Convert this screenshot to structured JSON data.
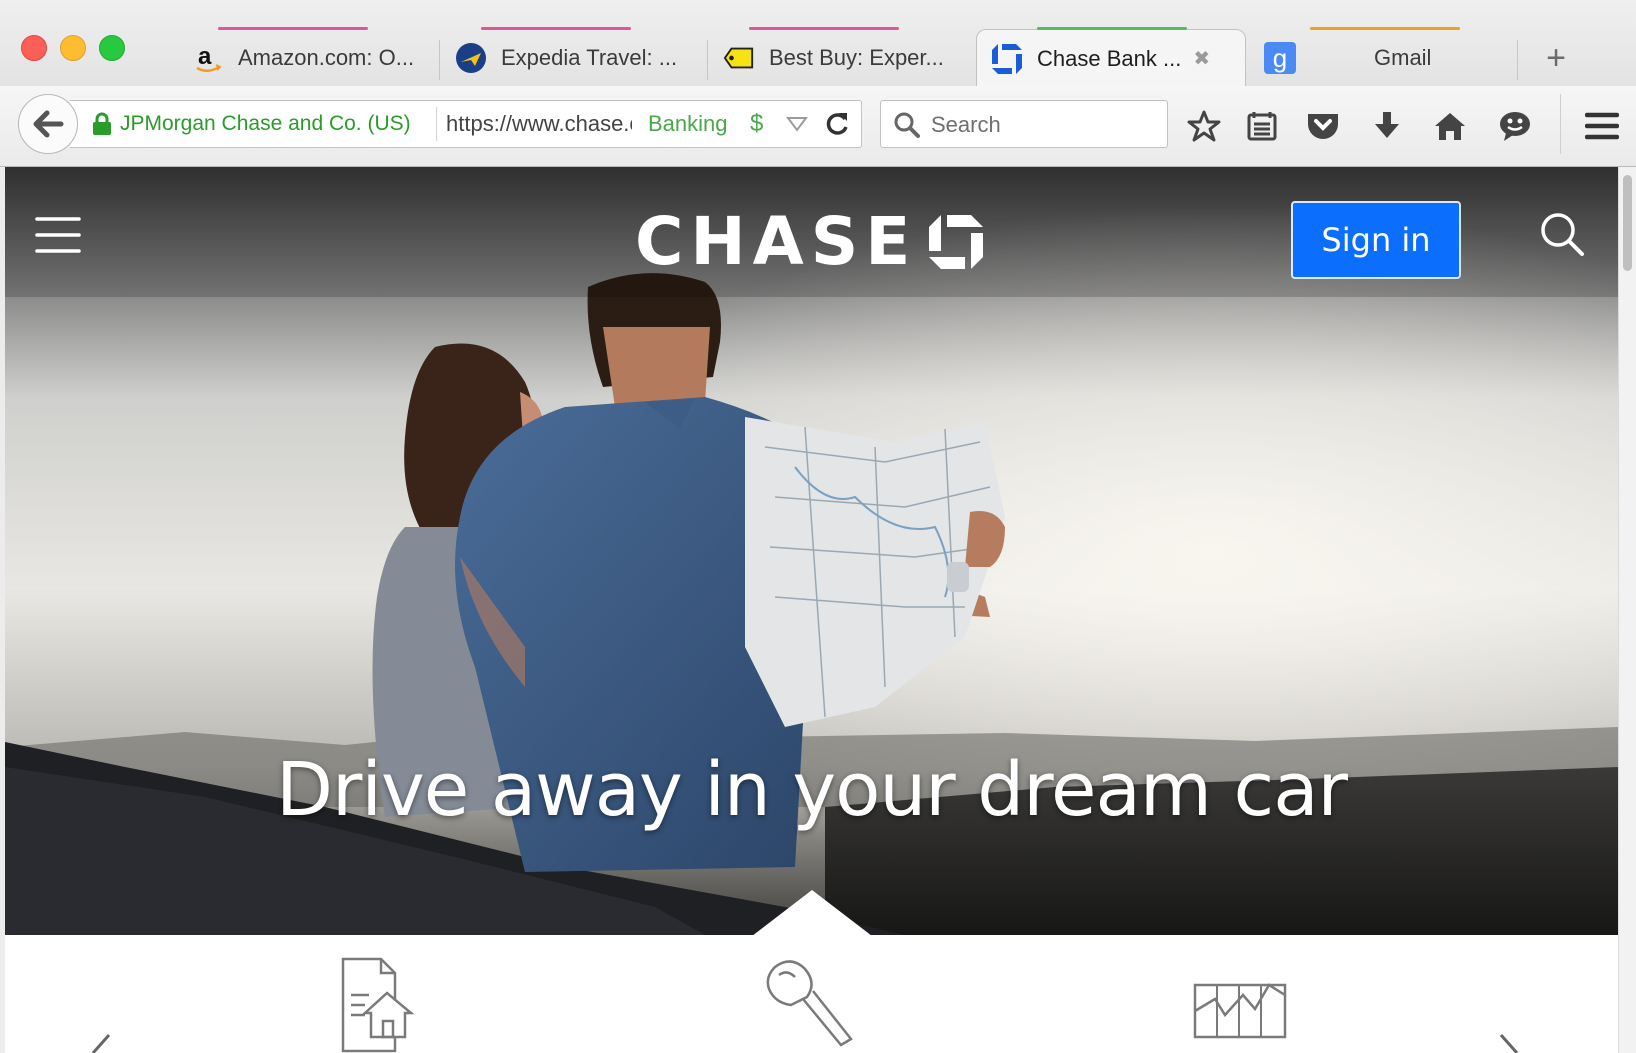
{
  "browser": {
    "tabs": [
      {
        "title": "Amazon.com: O...",
        "icon": "amazon-icon",
        "indicator_color": "#e0559a"
      },
      {
        "title": "Expedia Travel: ...",
        "icon": "expedia-icon",
        "indicator_color": "#e0559a"
      },
      {
        "title": "Best Buy: Exper...",
        "icon": "bestbuy-icon",
        "indicator_color": "#e0559a"
      },
      {
        "title": "Chase Bank ...",
        "icon": "chase-icon",
        "indicator_color": "#5cb85c",
        "active": true
      },
      {
        "title": "Gmail",
        "icon": "google-icon",
        "indicator_color": "#f0a020"
      }
    ],
    "new_tab": "+",
    "identity_label": "JPMorgan Chase and Co. (US)",
    "url": "https://www.chase.com",
    "url_badge": "Banking",
    "url_badge_symbol": "$",
    "search_placeholder": "Search",
    "toolbar_icons": [
      "bookmark-star-icon",
      "reading-list-icon",
      "pocket-icon",
      "download-icon",
      "home-icon",
      "chat-icon",
      "menu-icon"
    ]
  },
  "site": {
    "logo_text": "CHASE",
    "sign_in_label": "Sign in",
    "headline": "Drive away in your dream car",
    "product_icons": [
      "mortgage-icon",
      "auto-key-icon",
      "chart-icon"
    ],
    "brand_color": "#0b6efd"
  }
}
